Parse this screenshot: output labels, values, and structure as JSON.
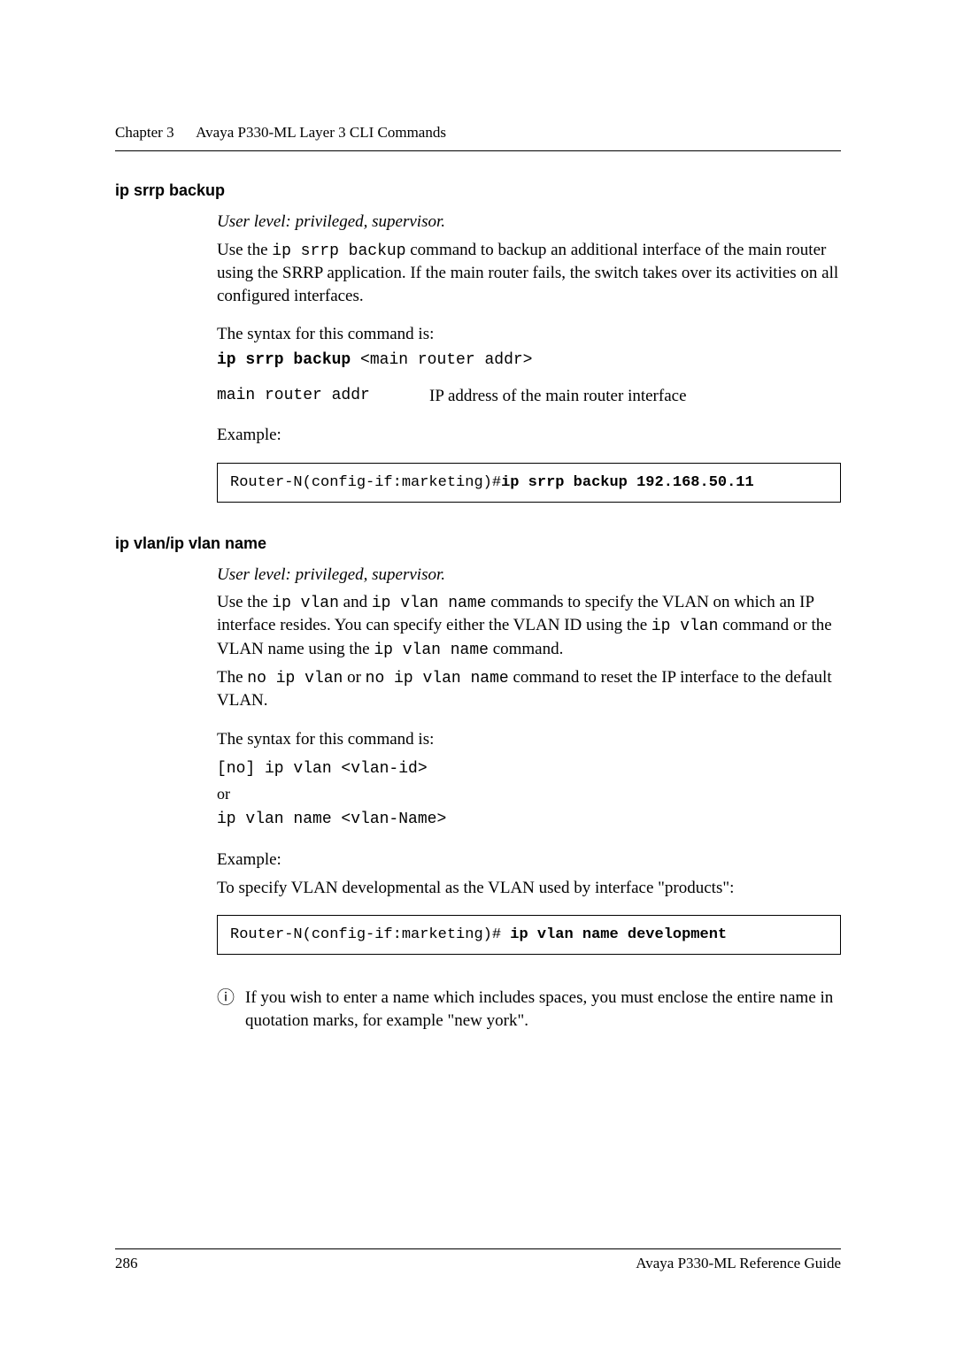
{
  "header": {
    "chapter_label": "Chapter 3",
    "chapter_title": "Avaya P330-ML Layer 3 CLI Commands"
  },
  "section1": {
    "heading": "ip srrp backup",
    "user_level": "User level: privileged, supervisor.",
    "desc_pre": "Use the ",
    "desc_mono": "ip srrp backup",
    "desc_post": " command to backup an additional interface of the main router using the SRRP application. If the main router fails, the switch takes over its activities on all configured interfaces.",
    "syntax_intro": "The syntax for this command is:",
    "syntax_bold": "ip srrp backup",
    "syntax_arg": " <main router addr>",
    "param_name": "main router addr",
    "param_desc": "IP address of the main router interface",
    "example_label": "Example:",
    "code_prompt": "Router-N(config-if:marketing)#",
    "code_cmd": "ip srrp backup 192.168.50.11"
  },
  "section2": {
    "heading": "ip vlan/ip vlan name",
    "user_level": "User level: privileged, supervisor.",
    "p1_a": "Use the ",
    "p1_m1": "ip vlan",
    "p1_b": " and ",
    "p1_m2": "ip vlan name",
    "p1_c": " commands to specify the VLAN on which an IP interface resides. You can specify either the VLAN ID using the ",
    "p1_m3": "ip vlan",
    "p1_d": " command or the VLAN name using the ",
    "p1_m4": "ip vlan name",
    "p1_e": " command.",
    "p2_a": "The ",
    "p2_m1": "no ip vlan",
    "p2_b": " or ",
    "p2_m2": "no ip vlan name",
    "p2_c": " command to reset the IP interface to the default VLAN.",
    "syntax_intro": "The syntax for this command is:",
    "syntax_line1": "[no] ip vlan <vlan-id>",
    "syntax_or": "or",
    "syntax_line2": "ip vlan name <vlan-Name>",
    "example_label": "Example:",
    "example_desc": "To specify VLAN developmental as the VLAN used by interface \"products\":",
    "code_prompt": "Router-N(config-if:marketing)# ",
    "code_cmd": "ip vlan name development",
    "note_icon": "ⓘ",
    "note_text": "If you wish to enter a name which includes spaces, you must enclose the entire name in quotation marks, for example \"new york\"."
  },
  "footer": {
    "page_number": "286",
    "doc_title": "Avaya P330-ML Reference Guide"
  }
}
